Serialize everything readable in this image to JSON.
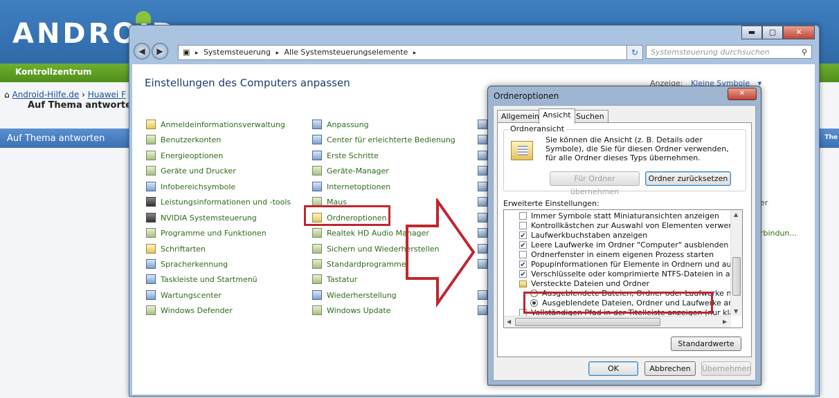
{
  "background_page": {
    "logo_text": "ANDROID",
    "menu_label": "Kontrollzentrum",
    "breadcrumb": [
      "Android-Hilfe.de",
      "Huawei F"
    ],
    "thread_title": "Auf Thema antworten",
    "section_bar": "Auf Thema antworten",
    "right_fragment": "The"
  },
  "control_panel": {
    "address_crumbs": [
      "Systemsteuerung",
      "Alle Systemsteuerungselemente"
    ],
    "search_placeholder": "Systemsteuerung durchsuchen",
    "heading": "Einstellungen des Computers anpassen",
    "view_label": "Anzeige:",
    "view_value": "Kleine Symbole",
    "column1": [
      {
        "label": "Anmeldeinformationsverwaltung",
        "icon": "credential-manager-icon"
      },
      {
        "label": "Benutzerkonten",
        "icon": "user-accounts-icon"
      },
      {
        "label": "Energieoptionen",
        "icon": "power-options-icon"
      },
      {
        "label": "Geräte und Drucker",
        "icon": "devices-printers-icon"
      },
      {
        "label": "Infobereichsymbole",
        "icon": "notification-area-icon"
      },
      {
        "label": "Leistungsinformationen und -tools",
        "icon": "performance-icon"
      },
      {
        "label": "NVIDIA Systemsteuerung",
        "icon": "nvidia-icon"
      },
      {
        "label": "Programme und Funktionen",
        "icon": "programs-icon"
      },
      {
        "label": "Schriftarten",
        "icon": "fonts-icon"
      },
      {
        "label": "Spracherkennung",
        "icon": "speech-icon"
      },
      {
        "label": "Taskleiste und Startmenü",
        "icon": "taskbar-icon"
      },
      {
        "label": "Wartungscenter",
        "icon": "action-center-icon"
      },
      {
        "label": "Windows Defender",
        "icon": "defender-icon"
      }
    ],
    "column2": [
      {
        "label": "Anpassung",
        "icon": "personalization-icon"
      },
      {
        "label": "Center für erleichterte Bedienung",
        "icon": "ease-of-access-icon"
      },
      {
        "label": "Erste Schritte",
        "icon": "getting-started-icon"
      },
      {
        "label": "Geräte-Manager",
        "icon": "device-manager-icon"
      },
      {
        "label": "Internetoptionen",
        "icon": "internet-options-icon"
      },
      {
        "label": "Maus",
        "icon": "mouse-icon"
      },
      {
        "label": "Ordneroptionen",
        "icon": "folder-options-icon"
      },
      {
        "label": "Realtek HD Audio Manager",
        "icon": "audio-icon"
      },
      {
        "label": "Sichern und Wiederherstellen",
        "icon": "backup-icon"
      },
      {
        "label": "Standardprogramme",
        "icon": "default-programs-icon"
      },
      {
        "label": "Tastatur",
        "icon": "keyboard-icon"
      },
      {
        "label": "Wiederherstellung",
        "icon": "recovery-icon"
      },
      {
        "label": "Windows Update",
        "icon": "windows-update-icon"
      }
    ],
    "right_fragments": [
      "er",
      "rbindun..."
    ]
  },
  "dialog": {
    "title": "Ordneroptionen",
    "tabs": [
      "Allgemein",
      "Ansicht",
      "Suchen"
    ],
    "active_tab": "Ansicht",
    "group_title": "Ordneransicht",
    "group_desc": "Sie können die Ansicht (z. B. Details oder Symbole), die Sie für diesen Ordner verwenden, für alle Ordner dieses Typs übernehmen.",
    "btn_apply_folders": "Für Ordner übernehmen",
    "btn_reset_folders": "Ordner zurücksetzen",
    "advanced_label": "Erweiterte Einstellungen:",
    "options": [
      {
        "type": "checkbox",
        "checked": false,
        "label": "Immer Symbole statt Miniaturansichten anzeigen"
      },
      {
        "type": "checkbox",
        "checked": false,
        "label": "Kontrollkästchen zur Auswahl von Elementen verwenden"
      },
      {
        "type": "checkbox",
        "checked": true,
        "label": "Laufwerkbuchstaben anzeigen"
      },
      {
        "type": "checkbox",
        "checked": true,
        "label": "Leere Laufwerke im Ordner \"Computer\" ausblenden"
      },
      {
        "type": "checkbox",
        "checked": false,
        "label": "Ordnerfenster in einem eigenen Prozess starten"
      },
      {
        "type": "checkbox",
        "checked": true,
        "label": "Popupinformationen für Elemente in Ordnern und auf dem D"
      },
      {
        "type": "checkbox",
        "checked": true,
        "label": "Verschlüsselte oder komprimierte NTFS-Dateien in anderer"
      },
      {
        "type": "folder",
        "label": "Versteckte Dateien und Ordner"
      },
      {
        "type": "radio",
        "checked": false,
        "label": "Ausgeblendete Dateien, Ordner oder Laufwerke nicht an"
      },
      {
        "type": "radio",
        "checked": true,
        "label": "Ausgeblendete Dateien, Ordner und Laufwerke anzeig"
      },
      {
        "type": "checkbox",
        "checked": false,
        "label": "Vollständigen Pfad in der Titelleiste anzeigen (nur klassisch"
      }
    ],
    "btn_defaults": "Standardwerte",
    "btn_ok": "OK",
    "btn_cancel": "Abbrechen",
    "btn_apply": "Übernehmen"
  },
  "colors": {
    "highlight": "#c0262f",
    "link_green": "#2d6b1a",
    "accent_blue": "#2b62b0"
  }
}
